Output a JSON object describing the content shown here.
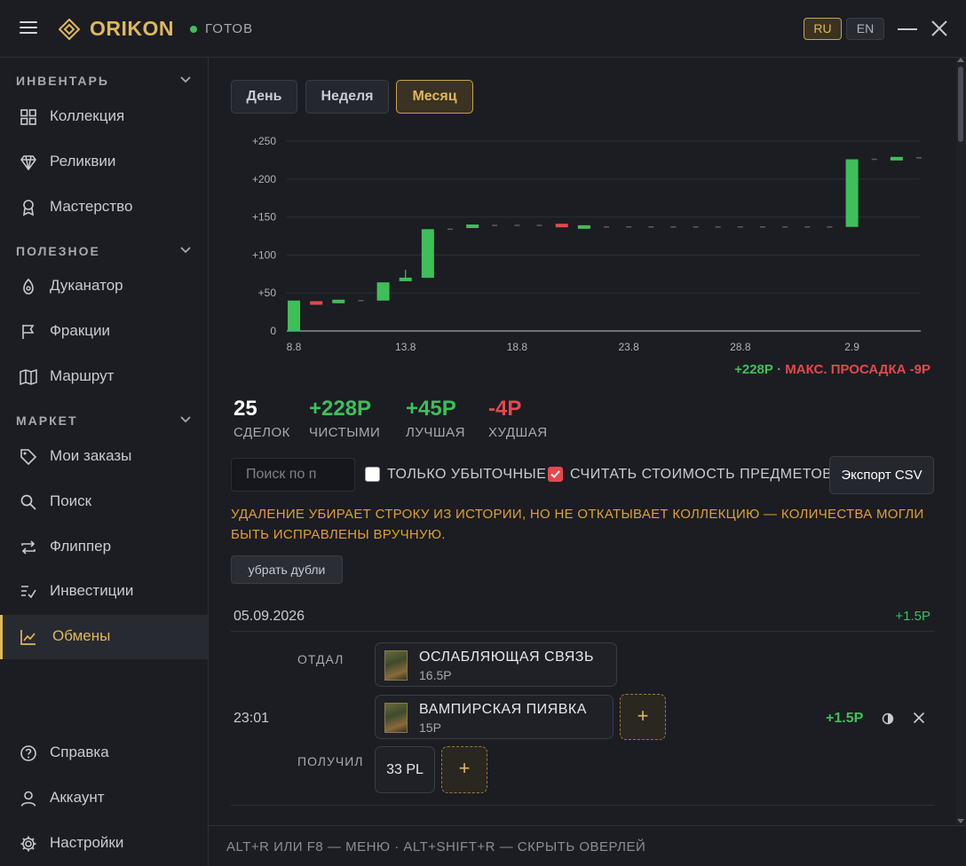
{
  "app": {
    "brand": "ORIKON",
    "status": "ГОТОВ",
    "lang_ru": "RU",
    "lang_en": "EN"
  },
  "sidebar": {
    "sections": [
      {
        "title": "ИНВЕНТАРЬ",
        "items": [
          "Коллекция",
          "Реликвии",
          "Мастерство"
        ]
      },
      {
        "title": "ПОЛЕЗНОЕ",
        "items": [
          "Дуканатор",
          "Фракции",
          "Маршрут"
        ]
      },
      {
        "title": "МАРКЕТ",
        "items": [
          "Мои заказы",
          "Поиск",
          "Флиппер",
          "Инвестиции",
          "Обмены"
        ]
      }
    ],
    "bottom": [
      "Справка",
      "Аккаунт",
      "Настройки"
    ],
    "active_item": "Обмены"
  },
  "periods": {
    "day": "День",
    "week": "Неделя",
    "month": "Месяц",
    "active": "Месяц"
  },
  "chart_data": {
    "type": "bar",
    "subtype": "waterfall-candles",
    "title": "",
    "xlabel": "",
    "ylabel": "",
    "ylim": [
      0,
      250
    ],
    "yticks": [
      "+250",
      "+200",
      "+150",
      "+100",
      "+50",
      "0"
    ],
    "yticks_values": [
      250,
      200,
      150,
      100,
      50,
      0
    ],
    "xticks": [
      "8.8",
      "13.8",
      "18.8",
      "23.8",
      "28.8",
      "2.9"
    ],
    "xticks_index": [
      0,
      5,
      10,
      15,
      20,
      25
    ],
    "grid": true,
    "colors": {
      "gain": "#3fbf5a",
      "loss": "#e5484d",
      "flat": "#5a5d65",
      "grid": "#2c2f37"
    },
    "candles": [
      {
        "i": 0,
        "open": 0,
        "close": 40
      },
      {
        "i": 1,
        "open": 38,
        "close": 35
      },
      {
        "i": 2,
        "open": 35,
        "close": 40
      },
      {
        "i": 3,
        "open": 40,
        "close": 40
      },
      {
        "i": 4,
        "open": 40,
        "close": 64
      },
      {
        "i": 5,
        "open": 66,
        "close": 69
      },
      {
        "i": 6,
        "open": 70,
        "close": 134
      },
      {
        "i": 7,
        "open": 134,
        "close": 134
      },
      {
        "i": 8,
        "open": 136,
        "close": 139
      },
      {
        "i": 9,
        "open": 139,
        "close": 139
      },
      {
        "i": 10,
        "open": 139,
        "close": 139
      },
      {
        "i": 11,
        "open": 139,
        "close": 139
      },
      {
        "i": 12,
        "open": 140,
        "close": 137
      },
      {
        "i": 13,
        "open": 136,
        "close": 138
      },
      {
        "i": 14,
        "open": 137,
        "close": 137
      },
      {
        "i": 15,
        "open": 137,
        "close": 137
      },
      {
        "i": 16,
        "open": 137,
        "close": 137
      },
      {
        "i": 17,
        "open": 137,
        "close": 137
      },
      {
        "i": 18,
        "open": 137,
        "close": 137
      },
      {
        "i": 19,
        "open": 137,
        "close": 137
      },
      {
        "i": 20,
        "open": 137,
        "close": 137
      },
      {
        "i": 21,
        "open": 137,
        "close": 137
      },
      {
        "i": 22,
        "open": 137,
        "close": 137
      },
      {
        "i": 23,
        "open": 137,
        "close": 137
      },
      {
        "i": 24,
        "open": 137,
        "close": 137
      },
      {
        "i": 25,
        "open": 137,
        "close": 226
      },
      {
        "i": 26,
        "open": 226,
        "close": 226
      },
      {
        "i": 27,
        "open": 226,
        "close": 228
      },
      {
        "i": 28,
        "open": 228,
        "close": 228
      }
    ],
    "wick_index": 5
  },
  "chart_summary": {
    "net": "+228Р",
    "sep": " · ",
    "drawdown": "МАКС. ПРОСАДКА -9Р"
  },
  "stats": [
    {
      "value": "25",
      "caption": "СДЕЛОК",
      "color": "#ffffff"
    },
    {
      "value": "+228Р",
      "caption": "ЧИСТЫМИ",
      "color": "#3fbf5a"
    },
    {
      "value": "+45Р",
      "caption": "ЛУЧШАЯ",
      "color": "#3fbf5a"
    },
    {
      "value": "-4Р",
      "caption": "ХУДШАЯ",
      "color": "#e5484d"
    }
  ],
  "filters": {
    "search_placeholder": "Поиск по п",
    "loss_only": "ТОЛЬКО УБЫТОЧНЫЕ",
    "count_items": "СЧИТАТЬ СТОИМОСТЬ ПРЕДМЕТОВ",
    "export": "Экспорт CSV"
  },
  "warning": "УДАЛЕНИЕ УБИРАЕТ СТРОКУ ИЗ ИСТОРИИ, НО НЕ ОТКАТЫВАЕТ КОЛЛЕКЦИЮ — КОЛИЧЕСТВА МОГЛИ БЫТЬ ИСПРАВЛЕНЫ ВРУЧНУЮ.",
  "dedupe": "убрать дубли",
  "history": {
    "date": "05.09.2026",
    "day_total": "+1.5Р",
    "trade": {
      "time": "23:01",
      "profit": "+1.5Р",
      "gave_label": "ОТДАЛ",
      "got_label": "ПОЛУЧИЛ",
      "gave": [
        {
          "name": "ОСЛАБЛЯЮЩАЯ СВЯЗЬ",
          "price": "16.5Р"
        },
        {
          "name": "ВАМПИРСКАЯ ПИЯВКА",
          "price": "15Р"
        }
      ],
      "got": "33 PL",
      "add": "+"
    }
  },
  "footer": "ALT+R ИЛИ F8 — МЕНЮ · ALT+SHIFT+R — СКРЫТЬ ОВЕРЛЕЙ"
}
